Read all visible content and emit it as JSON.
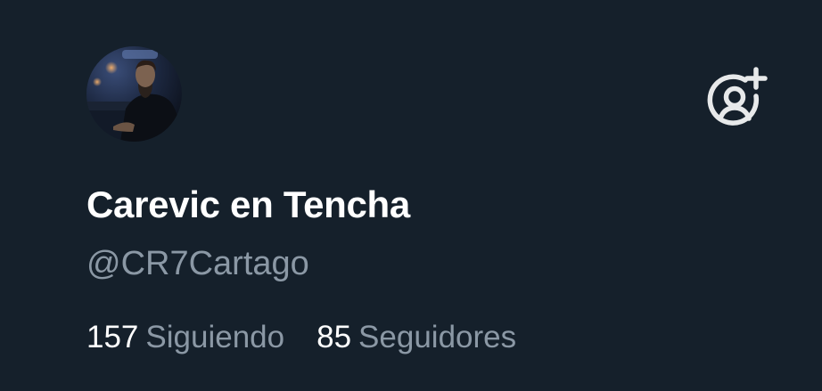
{
  "profile": {
    "display_name": "Carevic en Tencha",
    "handle": "@CR7Cartago",
    "following_count": "157",
    "following_label": "Siguiendo",
    "followers_count": "85",
    "followers_label": "Seguidores"
  },
  "icons": {
    "avatar": "profile-photo",
    "add_account": "person-add-icon"
  },
  "colors": {
    "background": "#15202b",
    "name": "#ffffff",
    "secondary_text": "#8b98a5",
    "icon": "#e7e9ea"
  }
}
